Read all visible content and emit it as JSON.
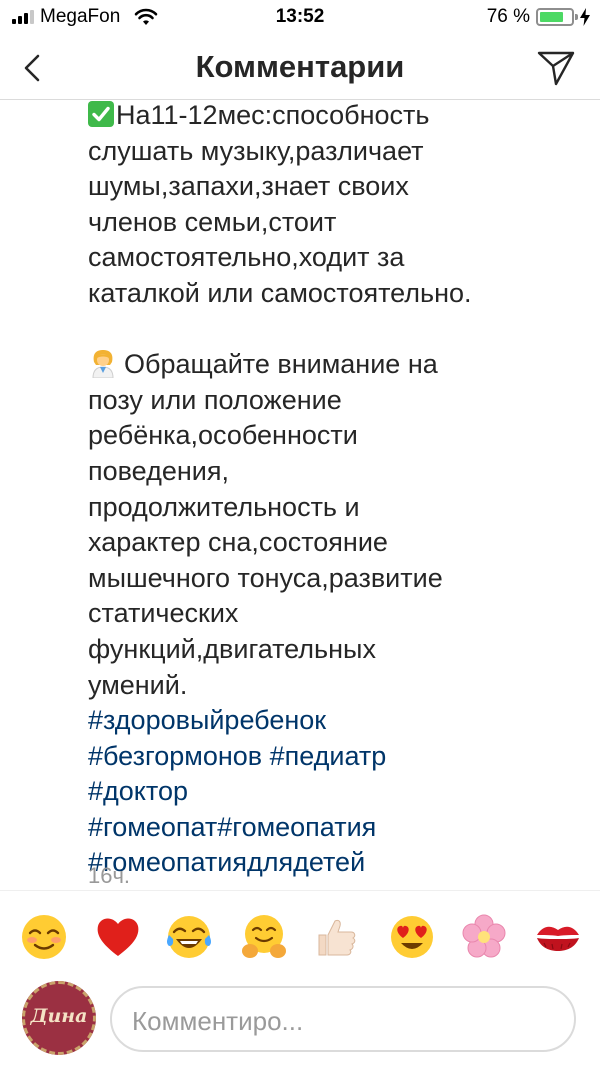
{
  "status_bar": {
    "carrier": "MegaFon",
    "time": "13:52",
    "battery_percent": "76 %",
    "battery_level": 0.76
  },
  "nav": {
    "title": "Комментарии"
  },
  "comment": {
    "lines_part1": [
      "На11-12мес:способность",
      "слушать музыку,различает",
      "шумы,запахи,знает своих",
      "членов семьи,стоит",
      "самостоятельно,ходит за",
      "каталкой или самостоятельно."
    ],
    "lines_part2": [
      "Обращайте внимание на",
      "позу или положение",
      "ребёнка,особенности",
      "поведения,",
      "продолжительность и",
      "характер сна,состояние",
      "мышечного тонуса,развитие",
      "статических",
      "функций,двигательных",
      "умений."
    ],
    "hashtag_lines": [
      "#здоровыйребенок",
      "#безгормонов #педиатр",
      "#доктор",
      "#гомеопат#гомеопатия",
      "#гомеопатиядлядетей"
    ],
    "timestamp": "16ч."
  },
  "reactions": [
    "☺️",
    "❤️",
    "😂",
    "🤗",
    "👍🏻",
    "😍",
    "🌸",
    "💋"
  ],
  "composer": {
    "avatar_text": "Дина",
    "placeholder": "Комментиро..."
  },
  "colors": {
    "hashtag": "#003569",
    "text": "#262626",
    "timestamp": "#999999",
    "battery": "#4cd964"
  }
}
